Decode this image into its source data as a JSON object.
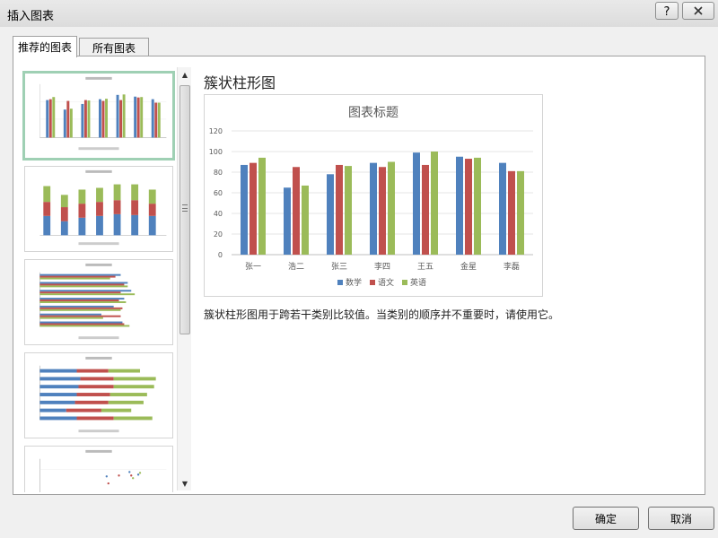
{
  "window": {
    "title": "插入图表"
  },
  "tabs": [
    {
      "label": "推荐的图表"
    },
    {
      "label": "所有图表"
    }
  ],
  "selected_chart": {
    "name": "簇状柱形图",
    "description": "簇状柱形图用于跨若干类别比较值。当类别的顺序并不重要时，请使用它。"
  },
  "buttons": {
    "ok": "确定",
    "cancel": "取消"
  },
  "colors": {
    "math": "#4f81bd",
    "chinese": "#c0504d",
    "english": "#9bbb59",
    "thumb_selected_border": "#9fd0b4"
  },
  "chart_data": {
    "type": "bar",
    "title": "图表标题",
    "categories": [
      "张一",
      "浩二",
      "张三",
      "李四",
      "王五",
      "金星",
      "李磊"
    ],
    "series": [
      {
        "name": "数学",
        "values": [
          87,
          65,
          78,
          89,
          99,
          95,
          89
        ]
      },
      {
        "name": "语文",
        "values": [
          89,
          85,
          87,
          85,
          87,
          93,
          81
        ]
      },
      {
        "name": "英语",
        "values": [
          94,
          67,
          86,
          90,
          100,
          94,
          81
        ]
      }
    ],
    "ylim": [
      0,
      120
    ],
    "yticks": [
      0,
      20,
      40,
      60,
      80,
      100,
      120
    ],
    "legend": "bottom",
    "grid": true
  }
}
